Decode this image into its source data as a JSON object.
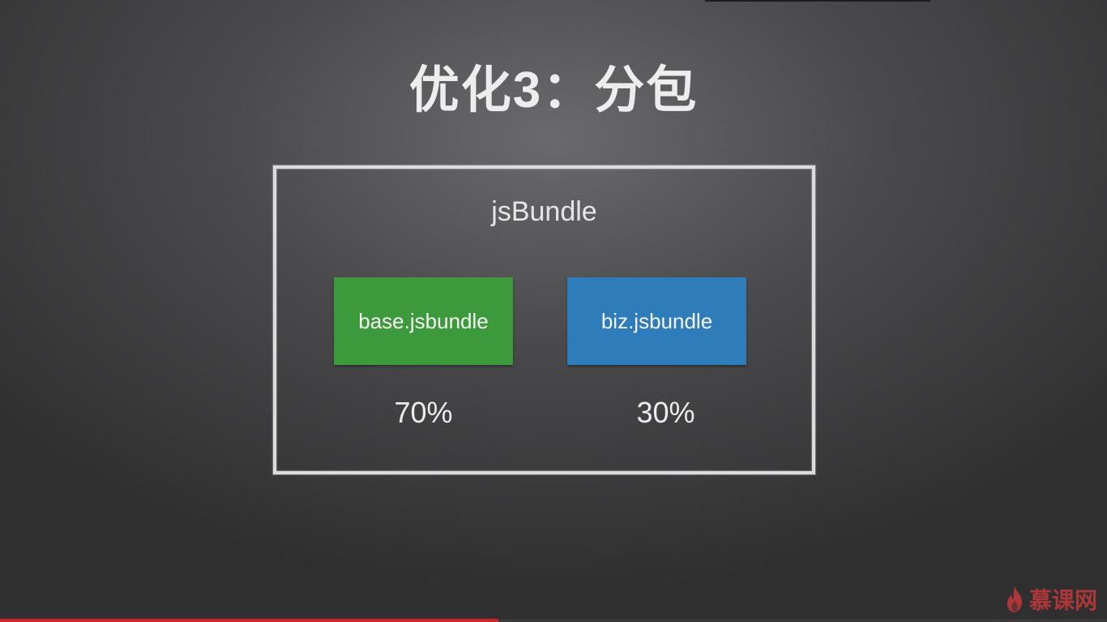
{
  "slide": {
    "title": "优化3：分包"
  },
  "diagram": {
    "container_label": "jsBundle",
    "bundles": [
      {
        "name": "base.jsbundle",
        "percent": "70%",
        "color": "#3d9a3c"
      },
      {
        "name": "biz.jsbundle",
        "percent": "30%",
        "color": "#2f7cbb"
      }
    ]
  },
  "player": {
    "progress_fraction": 0.45,
    "progress_color": "#d3262a"
  },
  "watermark": {
    "text": "慕课网",
    "icon": "flame-icon"
  }
}
